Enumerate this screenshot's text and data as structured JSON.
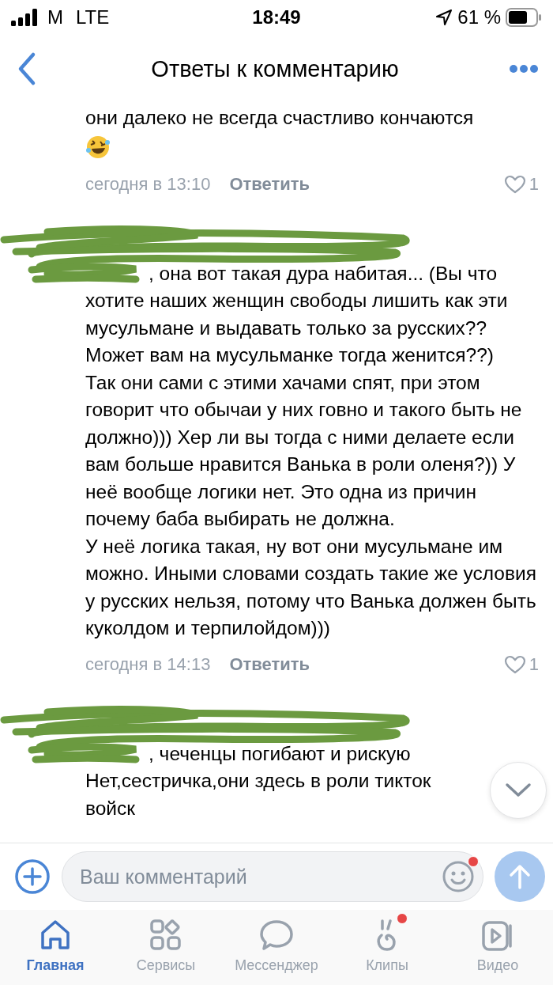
{
  "status_bar": {
    "carrier": "M",
    "network": "LTE",
    "time": "18:49",
    "battery": "61 %"
  },
  "nav": {
    "title": "Ответы к комментарию"
  },
  "comments": [
    {
      "header_redacted": false,
      "mention_redacted": false,
      "paragraphs": [
        "они далеко не всегда счастливо кончаются"
      ],
      "emoji": true,
      "meta": {
        "date": "сегодня в 13:10",
        "reply": "Ответить",
        "likes": "1"
      }
    },
    {
      "header_redacted": true,
      "mention_redacted": true,
      "paragraphs": [
        ", она вот такая дура набитая... (Вы что хотите наших женщин свободы лишить как эти мусульмане и выдавать только за русских?? Может вам на мусульманке тогда женится??)",
        "Так они сами с этими хачами спят, при этом говорит что обычаи у них говно и такого быть не должно))) Хер ли вы тогда с ними делаете если вам больше нравится Ванька в роли оленя?)) У неё вообще логики нет. Это одна из причин почему баба выбирать не должна.",
        "У неё логика такая, ну вот они мусульмане им можно. Иными словами создать такие же условия у русских нельзя, потому что Ванька должен быть куколдом и терпилойдом)))"
      ],
      "emoji": false,
      "meta": {
        "date": "сегодня в 14:13",
        "reply": "Ответить",
        "likes": "1"
      }
    },
    {
      "header_redacted": true,
      "mention_redacted": true,
      "paragraphs": [
        ", чеченцы погибают и рискую",
        "Нет,сестричка,они здесь в роли тикток",
        "войск"
      ],
      "emoji": false
    }
  ],
  "composer": {
    "placeholder": "Ваш комментарий",
    "emoji_badge": true
  },
  "tabs": [
    {
      "label": "Главная",
      "selected": true,
      "kind": "home",
      "badge": false
    },
    {
      "label": "Сервисы",
      "selected": false,
      "kind": "services",
      "badge": false
    },
    {
      "label": "Мессенджер",
      "selected": false,
      "kind": "messenger",
      "badge": false
    },
    {
      "label": "Клипы",
      "selected": false,
      "kind": "clips",
      "badge": true
    },
    {
      "label": "Видео",
      "selected": false,
      "kind": "video",
      "badge": false
    }
  ]
}
